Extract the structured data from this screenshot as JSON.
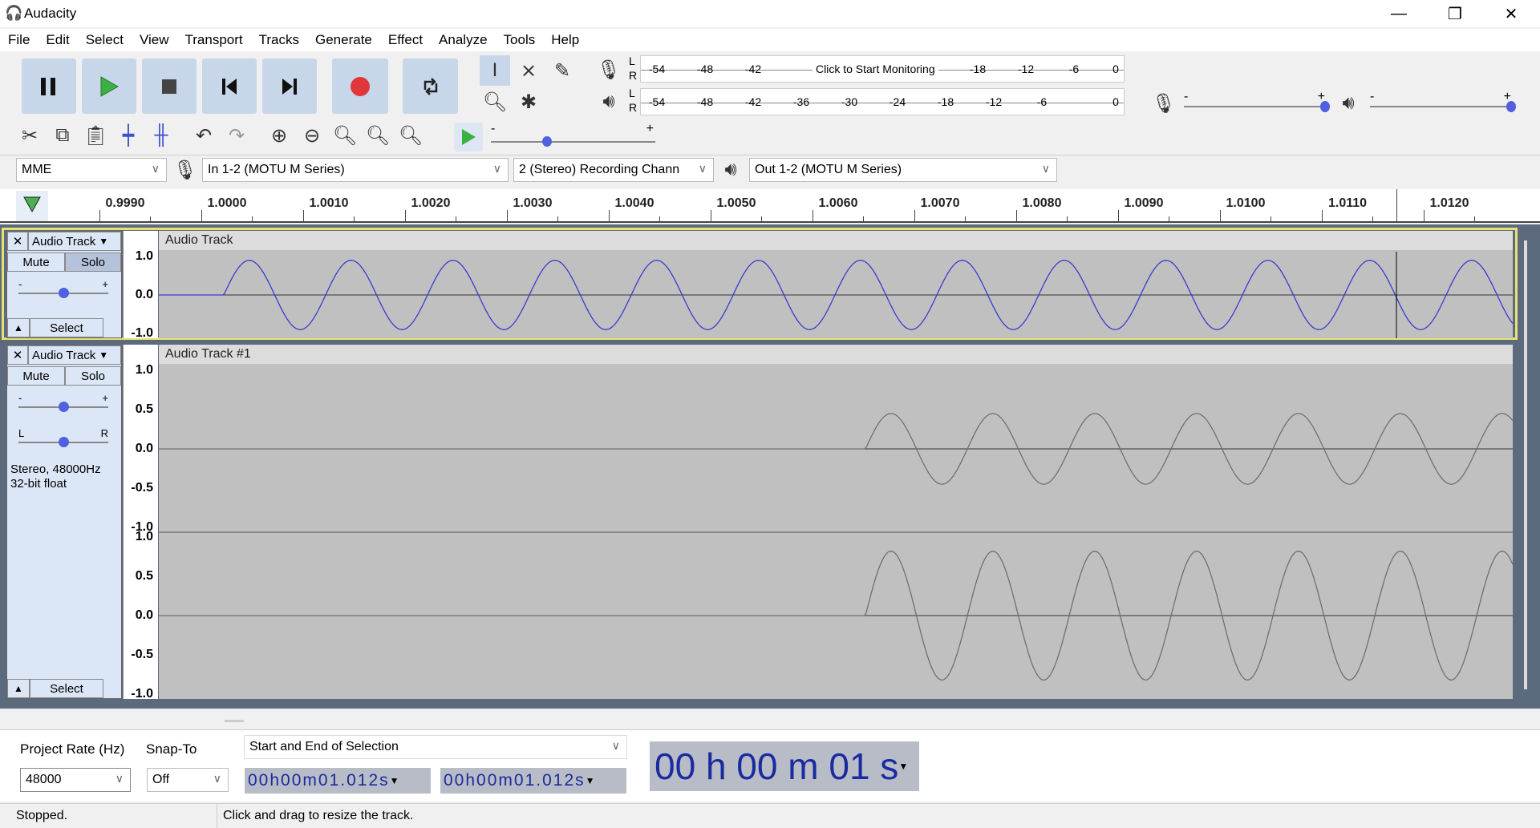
{
  "app": {
    "title": "Audacity"
  },
  "window": {
    "minimize": "—",
    "restore": "❐",
    "close": "✕"
  },
  "menu": [
    "File",
    "Edit",
    "Select",
    "View",
    "Transport",
    "Tracks",
    "Generate",
    "Effect",
    "Analyze",
    "Tools",
    "Help"
  ],
  "transport": {
    "pause": "pause-icon",
    "play": "play-icon",
    "stop": "stop-icon",
    "skip_start": "skip-start-icon",
    "skip_end": "skip-end-icon",
    "record": "record-icon",
    "loop": "loop-icon",
    "colors": {
      "play": "#3cb043",
      "record": "#e0373a",
      "button": "#c8d6ea"
    }
  },
  "meters": {
    "record_ticks": [
      "-54",
      "-48",
      "-42",
      "-18",
      "-12",
      "-6",
      "0"
    ],
    "monitor_label": "Click to Start Monitoring",
    "play_ticks": [
      "-54",
      "-48",
      "-42",
      "-36",
      "-30",
      "-24",
      "-18",
      "-12",
      "-6",
      "0"
    ],
    "channels": [
      "L",
      "R"
    ]
  },
  "sliders": {
    "minus": "-",
    "plus": "+"
  },
  "devices": {
    "host": "MME",
    "input": "In 1-2 (MOTU M Series)",
    "channels": "2 (Stereo) Recording Chann",
    "output": "Out 1-2 (MOTU M Series)"
  },
  "ruler": {
    "labels": [
      "0.9990",
      "1.0000",
      "1.0010",
      "1.0020",
      "1.0030",
      "1.0040",
      "1.0050",
      "1.0060",
      "1.0070",
      "1.0080",
      "1.0090",
      "1.0100",
      "1.0110",
      "1.0120"
    ]
  },
  "tracks": [
    {
      "name": "Audio Track",
      "title": "Audio Track",
      "mute": "Mute",
      "solo": "Solo",
      "select": "Select",
      "scale": [
        "1.0",
        "0.0",
        "-1.0"
      ],
      "selected": true,
      "wave_start_s": 1.0,
      "period_s": 0.001,
      "amplitude": [
        0.9
      ],
      "wave_color": "#3a3ad0"
    },
    {
      "name": "Audio Track",
      "title": "Audio Track #1",
      "mute": "Mute",
      "solo": "Solo",
      "select": "Select",
      "pan_l": "L",
      "pan_r": "R",
      "info1": "Stereo, 48000Hz",
      "info2": "32-bit float",
      "scale": [
        "1.0",
        "0.5",
        "0.0",
        "-0.5",
        "-1.0"
      ],
      "wave_start_s": 1.0063,
      "period_s": 0.001,
      "amplitude": [
        0.45,
        0.82
      ],
      "wave_color": "#707070"
    }
  ],
  "selection_bar": {
    "rate_label": "Project Rate (Hz)",
    "snap_label": "Snap-To",
    "rate": "48000",
    "snap": "Off",
    "mode": "Start and End of Selection",
    "start": "00h00m01.012s",
    "end": "00h00m01.012s",
    "audio_position": "00 h 00 m 01 s"
  },
  "status": {
    "state": "Stopped.",
    "hint": "Click and drag to resize the track."
  }
}
